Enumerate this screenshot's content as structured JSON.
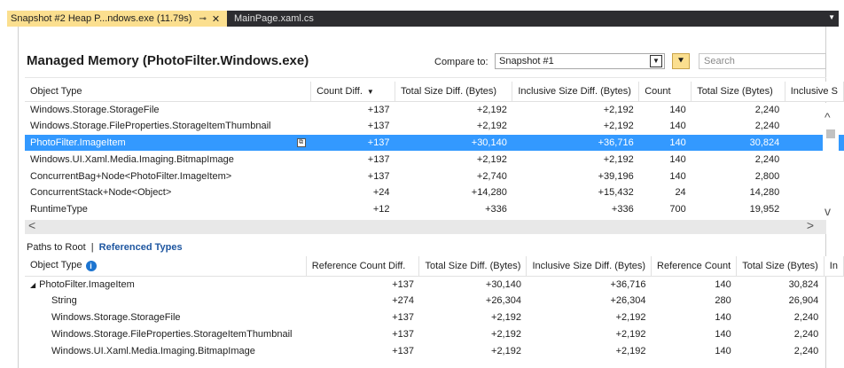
{
  "tabs": {
    "active_label": "Snapshot #2 Heap P...ndows.exe (11.79s)",
    "pin_glyph": "⊸",
    "close_glyph": "✕",
    "inactive_label": "MainPage.xaml.cs",
    "overflow_glyph": "▼"
  },
  "header": {
    "title": "Managed Memory (PhotoFilter.Windows.exe)",
    "compare_label": "Compare to:",
    "compare_value": "Snapshot #1",
    "search_placeholder": "Search"
  },
  "top_table": {
    "columns": [
      "Object Type",
      "Count Diff.",
      "Total Size Diff. (Bytes)",
      "Inclusive Size Diff. (Bytes)",
      "Count",
      "Total Size (Bytes)",
      "Inclusive S"
    ],
    "sorted_column": "Count Diff.",
    "rows": [
      {
        "type": "Windows.Storage.StorageFile",
        "count_diff": "+137",
        "total_size_diff": "+2,192",
        "inclusive_size_diff": "+2,192",
        "count": "140",
        "total_size": "2,240",
        "selected": false
      },
      {
        "type": "Windows.Storage.FileProperties.StorageItemThumbnail",
        "count_diff": "+137",
        "total_size_diff": "+2,192",
        "inclusive_size_diff": "+2,192",
        "count": "140",
        "total_size": "2,240",
        "selected": false
      },
      {
        "type": "PhotoFilter.ImageItem",
        "count_diff": "+137",
        "total_size_diff": "+30,140",
        "inclusive_size_diff": "+36,716",
        "count": "140",
        "total_size": "30,824",
        "selected": true
      },
      {
        "type": "Windows.UI.Xaml.Media.Imaging.BitmapImage",
        "count_diff": "+137",
        "total_size_diff": "+2,192",
        "inclusive_size_diff": "+2,192",
        "count": "140",
        "total_size": "2,240",
        "selected": false
      },
      {
        "type": "ConcurrentBag+Node<PhotoFilter.ImageItem>",
        "count_diff": "+137",
        "total_size_diff": "+2,740",
        "inclusive_size_diff": "+39,196",
        "count": "140",
        "total_size": "2,800",
        "selected": false
      },
      {
        "type": "ConcurrentStack+Node<Object>",
        "count_diff": "+24",
        "total_size_diff": "+14,280",
        "inclusive_size_diff": "+15,432",
        "count": "24",
        "total_size": "14,280",
        "selected": false
      },
      {
        "type": "RuntimeType",
        "count_diff": "+12",
        "total_size_diff": "+336",
        "inclusive_size_diff": "+336",
        "count": "700",
        "total_size": "19,952",
        "selected": false
      }
    ]
  },
  "subtabs": {
    "paths_to_root": "Paths to Root",
    "separator": "|",
    "referenced_types": "Referenced Types"
  },
  "bottom_table": {
    "columns": [
      "Object Type",
      "Reference Count Diff.",
      "Total Size Diff. (Bytes)",
      "Inclusive Size Diff. (Bytes)",
      "Reference Count",
      "Total Size (Bytes)",
      "In"
    ],
    "rows": [
      {
        "type": "PhotoFilter.ImageItem",
        "ref_count_diff": "+137",
        "total_size_diff": "+30,140",
        "inclusive_size_diff": "+36,716",
        "ref_count": "140",
        "total_size": "30,824",
        "expander": "◢",
        "indent": false
      },
      {
        "type": "String",
        "ref_count_diff": "+274",
        "total_size_diff": "+26,304",
        "inclusive_size_diff": "+26,304",
        "ref_count": "280",
        "total_size": "26,904",
        "expander": "",
        "indent": true
      },
      {
        "type": "Windows.Storage.StorageFile",
        "ref_count_diff": "+137",
        "total_size_diff": "+2,192",
        "inclusive_size_diff": "+2,192",
        "ref_count": "140",
        "total_size": "2,240",
        "expander": "",
        "indent": true
      },
      {
        "type": "Windows.Storage.FileProperties.StorageItemThumbnail",
        "ref_count_diff": "+137",
        "total_size_diff": "+2,192",
        "inclusive_size_diff": "+2,192",
        "ref_count": "140",
        "total_size": "2,240",
        "expander": "",
        "indent": true
      },
      {
        "type": "Windows.UI.Xaml.Media.Imaging.BitmapImage",
        "ref_count_diff": "+137",
        "total_size_diff": "+2,192",
        "inclusive_size_diff": "+2,192",
        "ref_count": "140",
        "total_size": "2,240",
        "expander": "",
        "indent": true
      }
    ]
  },
  "colors": {
    "tab_active_bg": "#fbdf8f",
    "tab_strip_bg": "#2d2d30",
    "selection_bg": "#3399ff",
    "link_blue": "#1e56a0"
  },
  "icons": {
    "info": "i",
    "sort_down": "▼",
    "filter": "⯆",
    "select_arrow": "▼",
    "scroll_up": "^",
    "scroll_down": "v",
    "scroll_left": "<",
    "scroll_right": ">",
    "row_glyph": "⧉"
  }
}
